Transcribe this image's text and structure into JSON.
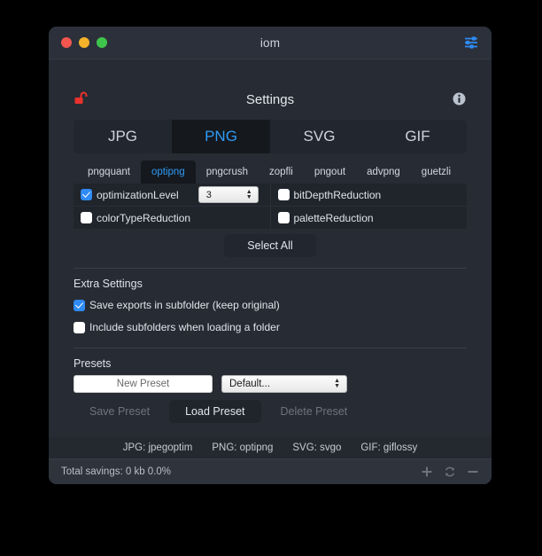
{
  "window": {
    "title": "iom",
    "traffic_lights": [
      "close-red",
      "minimize-yellow",
      "zoom-green"
    ],
    "toolbar_icon": "sliders-icon"
  },
  "settings": {
    "heading": "Settings",
    "lock_icon": "unlocked-padlock-icon",
    "lock_color": "#e8312c",
    "info_icon": "info-circle-icon"
  },
  "format_tabs": [
    {
      "label": "JPG",
      "active": false
    },
    {
      "label": "PNG",
      "active": true
    },
    {
      "label": "SVG",
      "active": false
    },
    {
      "label": "GIF",
      "active": false
    }
  ],
  "sub_tabs": [
    {
      "label": "pngquant",
      "active": false
    },
    {
      "label": "optipng",
      "active": true
    },
    {
      "label": "pngcrush",
      "active": false
    },
    {
      "label": "zopfli",
      "active": false
    },
    {
      "label": "pngout",
      "active": false
    },
    {
      "label": "advpng",
      "active": false
    },
    {
      "label": "guetzli",
      "active": false
    }
  ],
  "options": {
    "left": [
      {
        "label": "optimizationLevel",
        "checked": true,
        "stepper_value": "3"
      },
      {
        "label": "colorTypeReduction",
        "checked": false
      }
    ],
    "right": [
      {
        "label": "bitDepthReduction",
        "checked": false
      },
      {
        "label": "paletteReduction",
        "checked": false
      }
    ],
    "select_all_label": "Select All"
  },
  "extra_settings": {
    "title": "Extra Settings",
    "items": [
      {
        "label": "Save exports in subfolder (keep original)",
        "checked": true
      },
      {
        "label": "Include subfolders when loading a folder",
        "checked": false
      }
    ]
  },
  "presets": {
    "title": "Presets",
    "new_preset_placeholder": "New Preset",
    "new_preset_value": "",
    "selected_preset": "Default...",
    "buttons": [
      {
        "label": "Save Preset",
        "enabled": false
      },
      {
        "label": "Load Preset",
        "enabled": true
      },
      {
        "label": "Delete Preset",
        "enabled": false
      }
    ]
  },
  "engines": [
    "JPG: jpegoptim",
    "PNG: optipng",
    "SVG: svgo",
    "GIF: giflossy"
  ],
  "statusbar": {
    "savings_text": "Total savings: 0 kb 0.0%",
    "icons": [
      "plus-icon",
      "refresh-icon",
      "minus-icon"
    ]
  },
  "colors": {
    "accent_blue": "#2f9bf5",
    "window_bg": "#272b33",
    "titlebar_bg": "#2b303a",
    "panel_bg": "#20242b",
    "tab_bg": "#22262e",
    "active_tab_bg": "#15181d",
    "statusbar_bg": "#2e333c",
    "lock_red": "#e8312c"
  }
}
